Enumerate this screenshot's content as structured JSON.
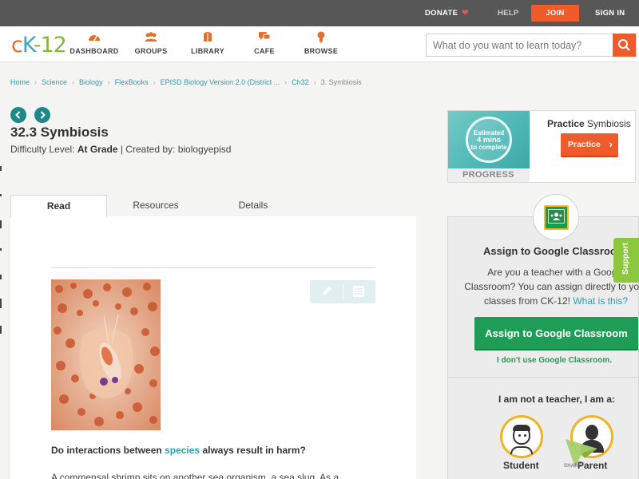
{
  "topbar": {
    "donate": "DONATE",
    "help": "HELP",
    "join": "JOIN",
    "signin": "SIGN IN"
  },
  "header": {
    "logo": {
      "c": "c",
      "k": "K",
      "dash": "-",
      "num": "12"
    },
    "nav": [
      {
        "label": "DASHBOARD",
        "icon": "dashboard-icon"
      },
      {
        "label": "GROUPS",
        "icon": "groups-icon"
      },
      {
        "label": "LIBRARY",
        "icon": "library-icon"
      },
      {
        "label": "CAFE",
        "icon": "cafe-icon"
      },
      {
        "label": "BROWSE",
        "icon": "browse-icon"
      }
    ],
    "search": {
      "placeholder": "What do you want to learn today?"
    }
  },
  "breadcrumb": [
    "Home",
    "Science",
    "Biology",
    "FlexBooks",
    "EPISD Biology Version 2.0 (District ...",
    "Ch32",
    "3. Symbiosis"
  ],
  "title": "32.3 Symbiosis",
  "meta": {
    "difficulty_label": "Difficulty Level:",
    "difficulty": "At Grade",
    "created_label": "| Created by:",
    "author": "biologyepisd"
  },
  "tabs": [
    "Read",
    "Resources",
    "Details"
  ],
  "content": {
    "question_prefix": "Do interactions between",
    "question_keyword": "species",
    "question_suffix": "always result in harm?",
    "paragraph": "A commensal shrimp sits on another sea organism, a sea slug. As a"
  },
  "practice": {
    "estimated": "Estimated",
    "mins": "4 mins",
    "to_complete": "to complete",
    "progress": "PROGRESS",
    "title_prefix": "Practice",
    "title_topic": "Symbiosis",
    "button": "Practice"
  },
  "classroom": {
    "title": "Assign to Google Classroom",
    "line1": "Are you a teacher with a Google",
    "line2": "Classroom? You can assign directly to your",
    "line3": "classes from CK-12!",
    "what_link": "What is this?",
    "button": "Assign to Google Classroom",
    "no_use": "I don't use Google Classroom.",
    "i_am": "I am not a teacher, I am a:",
    "student": "Student",
    "parent": "Parent"
  },
  "support": "Support",
  "share_label": "SHARE",
  "colors": {
    "orange": "#ef5b2b",
    "teal": "#2d9cb1",
    "green": "#1f9d56",
    "support_green": "#8dc63f",
    "gold": "#f0b323"
  }
}
